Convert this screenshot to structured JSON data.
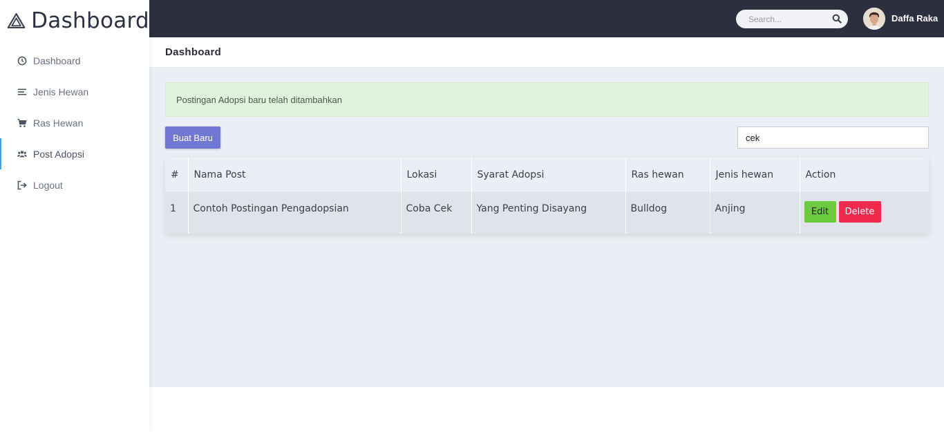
{
  "brand": {
    "title": "Dashboard",
    "icon": "triangle-logo-icon"
  },
  "sidebar": {
    "items": [
      {
        "label": "Dashboard",
        "icon": "clock-icon"
      },
      {
        "label": "Jenis Hewan",
        "icon": "list-icon"
      },
      {
        "label": "Ras Hewan",
        "icon": "cart-icon"
      },
      {
        "label": "Post Adopsi",
        "icon": "users-icon",
        "active": true
      },
      {
        "label": "Logout",
        "icon": "logout-icon"
      }
    ],
    "accent": "#3ea2ea"
  },
  "topbar": {
    "search_placeholder": "Search...",
    "user_name": "Daffa Raka",
    "background": "#2d2f3e"
  },
  "page": {
    "title": "Dashboard"
  },
  "alert": {
    "message": "Postingan Adopsi baru telah ditambahkan"
  },
  "toolbar": {
    "new_button": "Buat Baru",
    "filter_value": "cek"
  },
  "table": {
    "headers": [
      "#",
      "Nama Post",
      "Lokasi",
      "Syarat Adopsi",
      "Ras hewan",
      "Jenis hewan",
      "Action"
    ],
    "rows": [
      {
        "no": "1",
        "nama_post": "Contoh Postingan Pengadopsian",
        "lokasi": "Coba Cek",
        "syarat": "Yang Penting Disayang",
        "ras": "Bulldog",
        "jenis": "Anjing",
        "edit_label": "Edit",
        "delete_label": "Delete"
      }
    ]
  },
  "colors": {
    "primary": "#7178d4",
    "success": "#6acb3e",
    "danger": "#f0294f",
    "alert_bg": "#e1f3db"
  }
}
